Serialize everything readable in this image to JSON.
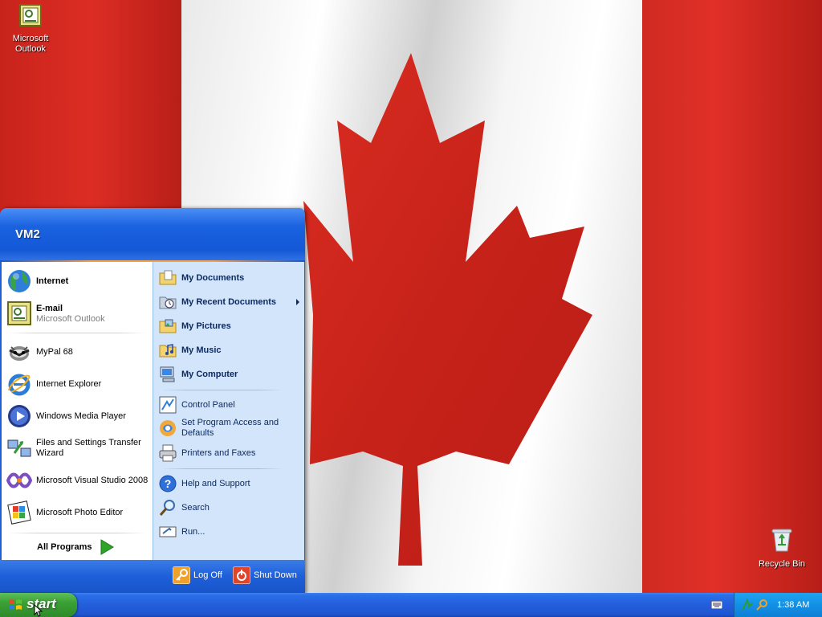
{
  "desktop": {
    "icons": [
      {
        "label": "Microsoft Outlook"
      },
      {
        "label": "Recycle Bin"
      }
    ]
  },
  "start_menu": {
    "user": "VM2",
    "pinned": [
      {
        "label": "Internet",
        "icon": "globe-icon"
      },
      {
        "label": "E-mail",
        "sublabel": "Microsoft Outlook",
        "icon": "outlook-icon"
      }
    ],
    "recent": [
      {
        "label": "MyPal 68",
        "icon": "mypal-icon"
      },
      {
        "label": "Internet Explorer",
        "icon": "ie-icon"
      },
      {
        "label": "Windows Media Player",
        "icon": "media-player-icon"
      },
      {
        "label": "Files and Settings Transfer Wizard",
        "icon": "transfer-wizard-icon"
      },
      {
        "label": "Microsoft Visual Studio 2008",
        "icon": "visual-studio-icon"
      },
      {
        "label": "Microsoft Photo Editor",
        "icon": "photo-editor-icon"
      }
    ],
    "all_programs": "All Programs",
    "places": [
      {
        "label": "My Documents",
        "icon": "folder-documents-icon"
      },
      {
        "label": "My Recent Documents",
        "icon": "recent-documents-icon"
      },
      {
        "label": "My Pictures",
        "icon": "folder-pictures-icon"
      },
      {
        "label": "My Music",
        "icon": "folder-music-icon"
      },
      {
        "label": "My Computer",
        "icon": "computer-icon"
      }
    ],
    "settings": [
      {
        "label": "Control Panel",
        "icon": "control-panel-icon"
      },
      {
        "label": "Set Program Access and Defaults",
        "icon": "program-defaults-icon"
      },
      {
        "label": "Printers and Faxes",
        "icon": "printer-icon"
      }
    ],
    "tools": [
      {
        "label": "Help and Support",
        "icon": "help-icon"
      },
      {
        "label": "Search",
        "icon": "search-icon"
      },
      {
        "label": "Run...",
        "icon": "run-icon"
      }
    ],
    "log_off": "Log Off",
    "shut_down": "Shut Down"
  },
  "taskbar": {
    "start_label": "start",
    "clock": "1:38 AM"
  },
  "colors": {
    "flag_red": "#d52b1e",
    "taskbar_blue": "#245edb",
    "start_green": "#3aa135",
    "tray_blue": "#1290e6"
  }
}
